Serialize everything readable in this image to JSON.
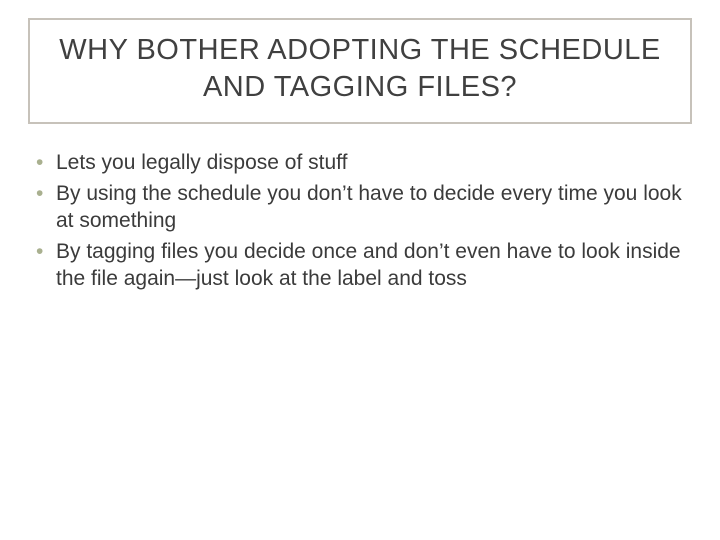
{
  "title": "WHY BOTHER ADOPTING THE SCHEDULE AND TAGGING FILES?",
  "bullets": [
    "Lets you legally dispose of stuff",
    "By using the schedule you don’t have to decide every time you look at something",
    "By tagging files you decide once and don’t even have to look inside the file again—just look at the label and toss"
  ]
}
